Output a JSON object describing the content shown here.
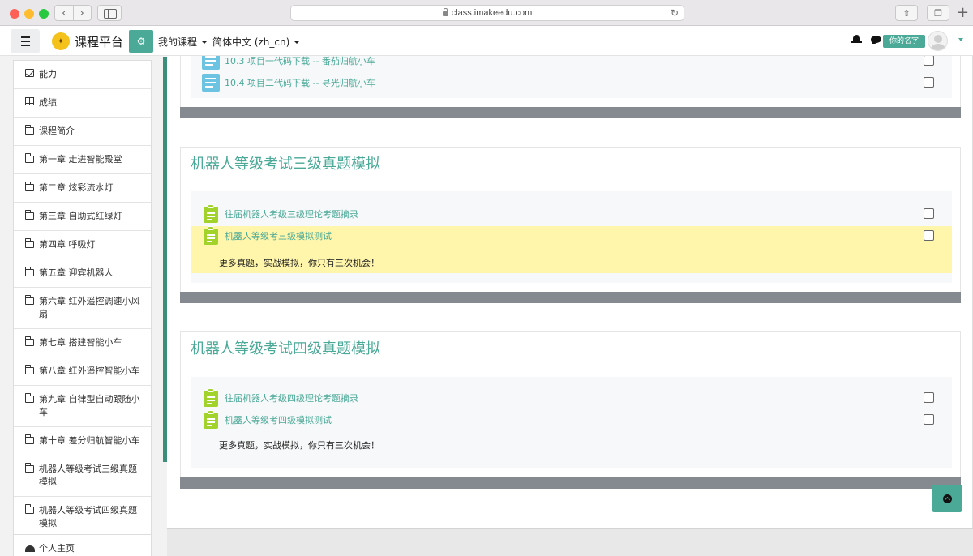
{
  "browser": {
    "url": "class.imakeedu.com"
  },
  "navbar": {
    "brand": "课程平台",
    "my_courses": "我的课程",
    "language": "简体中文 (zh_cn)",
    "username": "你的名字"
  },
  "drawer": {
    "items": [
      {
        "label": "能力",
        "icon": "check-square-icon"
      },
      {
        "label": "成绩",
        "icon": "table-icon"
      },
      {
        "label": "课程简介",
        "icon": "folder-icon"
      },
      {
        "label": "第一章 走进智能殿堂",
        "icon": "folder-icon"
      },
      {
        "label": "第二章 炫彩流水灯",
        "icon": "folder-icon"
      },
      {
        "label": "第三章 自助式红绿灯",
        "icon": "folder-icon"
      },
      {
        "label": "第四章 呼吸灯",
        "icon": "folder-icon"
      },
      {
        "label": "第五章 迎宾机器人",
        "icon": "folder-icon"
      },
      {
        "label": "第六章 红外遥控调速小风扇",
        "icon": "folder-icon"
      },
      {
        "label": "第七章 搭建智能小车",
        "icon": "folder-icon"
      },
      {
        "label": "第八章 红外遥控智能小车",
        "icon": "folder-icon"
      },
      {
        "label": "第九章 自律型自动跟随小车",
        "icon": "folder-icon"
      },
      {
        "label": "第十章 差分归航智能小车",
        "icon": "folder-icon"
      },
      {
        "label": "机器人等级考试三级真题模拟",
        "icon": "folder-icon"
      },
      {
        "label": "机器人等级考试四级真题模拟",
        "icon": "folder-icon"
      }
    ],
    "home": "个人主页"
  },
  "sections": {
    "top": {
      "activities": [
        {
          "label": "10.3 项目一代码下载 -- 番茄归航小车"
        },
        {
          "label": "10.4 项目二代码下载 -- 寻光归航小车"
        }
      ]
    },
    "level3": {
      "title": "机器人等级考试三级真题模拟",
      "activities": [
        {
          "label": "往届机器人考级三级理论考题摘录"
        },
        {
          "label": "机器人等级考三级模拟测试"
        }
      ],
      "description": "更多真题，实战模拟，你只有三次机会！"
    },
    "level4": {
      "title": "机器人等级考试四级真题模拟",
      "activities": [
        {
          "label": "往届机器人考级四级理论考题摘录"
        },
        {
          "label": "机器人等级考四级模拟测试"
        }
      ],
      "description": "更多真题，实战模拟，你只有三次机会！"
    }
  },
  "colors": {
    "accent": "#4aa997",
    "highlight": "#fff5ab",
    "quiz": "#a1d32a",
    "page": "#6cc3e2"
  }
}
